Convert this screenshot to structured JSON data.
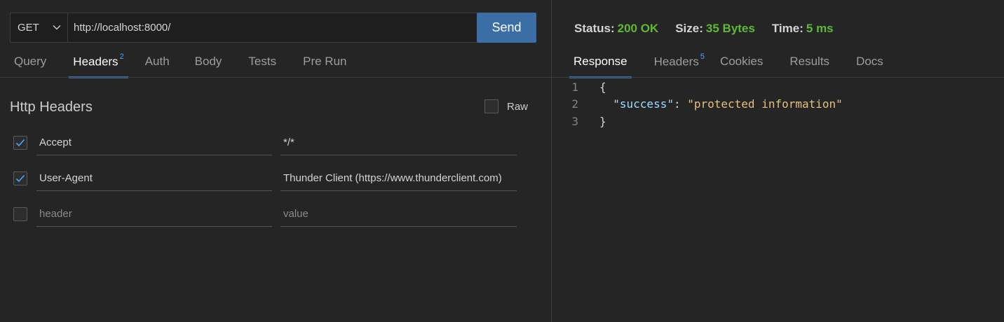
{
  "request": {
    "method": "GET",
    "url": "http://localhost:8000/",
    "send_label": "Send",
    "tabs": [
      {
        "label": "Query",
        "badge": ""
      },
      {
        "label": "Headers",
        "badge": "2"
      },
      {
        "label": "Auth",
        "badge": ""
      },
      {
        "label": "Body",
        "badge": ""
      },
      {
        "label": "Tests",
        "badge": ""
      },
      {
        "label": "Pre Run",
        "badge": ""
      }
    ],
    "active_tab": "Headers",
    "section_title": "Http Headers",
    "raw_label": "Raw",
    "headers": [
      {
        "key": "Accept",
        "value": "*/*",
        "checked": true
      },
      {
        "key": "User-Agent",
        "value": "Thunder Client (https://www.thunderclient.com)",
        "checked": true
      }
    ],
    "new_header_placeholder": "header",
    "new_value_placeholder": "value"
  },
  "response": {
    "status_label": "Status:",
    "status_value": "200 OK",
    "size_label": "Size:",
    "size_value": "35 Bytes",
    "time_label": "Time:",
    "time_value": "5 ms",
    "tabs": [
      {
        "label": "Response",
        "badge": ""
      },
      {
        "label": "Headers",
        "badge": "5"
      },
      {
        "label": "Cookies",
        "badge": ""
      },
      {
        "label": "Results",
        "badge": ""
      },
      {
        "label": "Docs",
        "badge": ""
      }
    ],
    "active_tab": "Response",
    "lines": [
      {
        "num": "1",
        "text": "{"
      },
      {
        "num": "2",
        "key": "\"success\"",
        "sep": ": ",
        "value": "\"protected information\""
      },
      {
        "num": "3",
        "text": "}"
      }
    ]
  },
  "colors": {
    "accent": "#3a6ea5",
    "status_green": "#5fb936",
    "badge_blue": "#4fa3ff"
  },
  "icons": {
    "method_dropdown": "chevron-down-icon",
    "checkbox_checked": "checkmark-icon"
  }
}
